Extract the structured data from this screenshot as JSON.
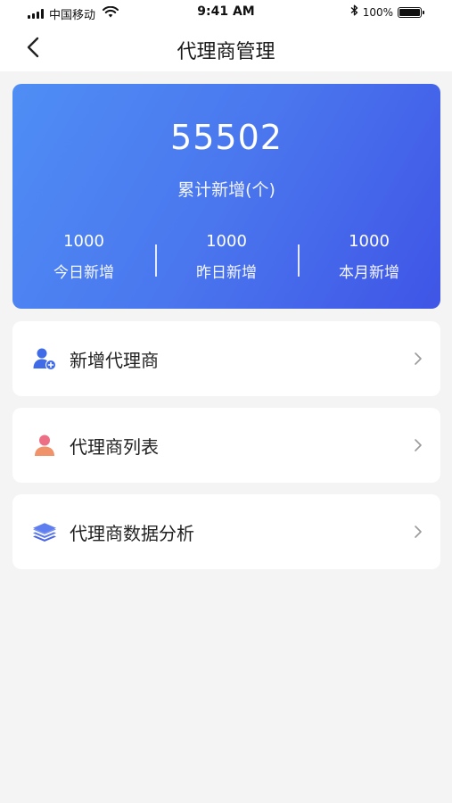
{
  "status_bar": {
    "carrier": "中国移动",
    "time": "9:41 AM",
    "battery_percent": "100%"
  },
  "nav": {
    "title": "代理商管理"
  },
  "stats": {
    "total_value": "55502",
    "total_label": "累计新增(个)",
    "items": [
      {
        "value": "1000",
        "label": "今日新增"
      },
      {
        "value": "1000",
        "label": "昨日新增"
      },
      {
        "value": "1000",
        "label": "本月新增"
      }
    ]
  },
  "menu": {
    "items": [
      {
        "label": "新增代理商",
        "icon": "add-user-icon"
      },
      {
        "label": "代理商列表",
        "icon": "person-icon"
      },
      {
        "label": "代理商数据分析",
        "icon": "layers-icon"
      }
    ]
  },
  "colors": {
    "card_gradient_start": "#4f8ef5",
    "card_gradient_end": "#3f55e6",
    "page_background": "#f4f4f5",
    "person_icon": "#ea7b7e",
    "accent_blue": "#3f6ae8"
  }
}
